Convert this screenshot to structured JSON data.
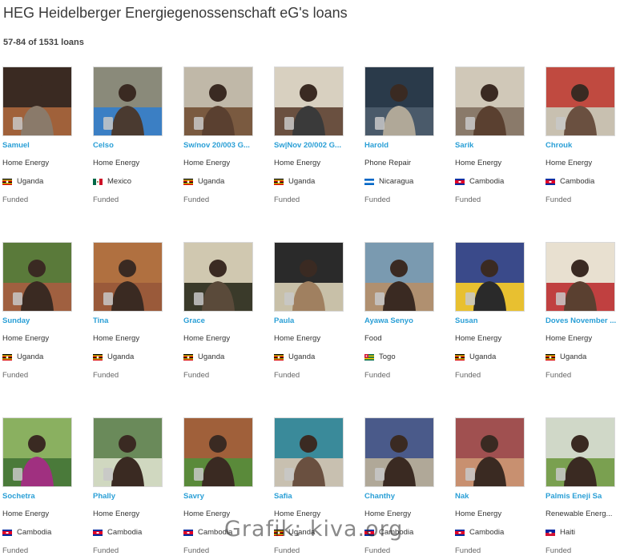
{
  "header": {
    "title": "HEG Heidelberger Energiegenossenschaft eG's loans",
    "count": "57-84 of 1531 loans"
  },
  "colors": {
    "accent_link": "#2a9fd6",
    "text": "#333333",
    "muted": "#666666"
  },
  "loans": [
    {
      "name": "Samuel",
      "sector": "Home Energy",
      "country": "Uganda",
      "flag": "flag-uganda",
      "status": "Funded",
      "photo": "borrower-photo"
    },
    {
      "name": "Celso",
      "sector": "Home Energy",
      "country": "Mexico",
      "flag": "flag-mexico",
      "status": "Funded",
      "photo": "borrower-photo"
    },
    {
      "name": "Sw/nov 20/003 G...",
      "sector": "Home Energy",
      "country": "Uganda",
      "flag": "flag-uganda",
      "status": "Funded",
      "photo": "borrower-photo"
    },
    {
      "name": "Sw|Nov 20/002 G...",
      "sector": "Home Energy",
      "country": "Uganda",
      "flag": "flag-uganda",
      "status": "Funded",
      "photo": "borrower-photo"
    },
    {
      "name": "Harold",
      "sector": "Phone Repair",
      "country": "Nicaragua",
      "flag": "flag-nicaragua",
      "status": "Funded",
      "photo": "borrower-photo"
    },
    {
      "name": "Sarik",
      "sector": "Home Energy",
      "country": "Cambodia",
      "flag": "flag-cambodia",
      "status": "Funded",
      "photo": "borrower-photo"
    },
    {
      "name": "Chrouk",
      "sector": "Home Energy",
      "country": "Cambodia",
      "flag": "flag-cambodia",
      "status": "Funded",
      "photo": "borrower-photo"
    },
    {
      "name": "Sunday",
      "sector": "Home Energy",
      "country": "Uganda",
      "flag": "flag-uganda",
      "status": "Funded",
      "photo": "borrower-photo"
    },
    {
      "name": "Tina",
      "sector": "Home Energy",
      "country": "Uganda",
      "flag": "flag-uganda",
      "status": "Funded",
      "photo": "borrower-photo"
    },
    {
      "name": "Grace",
      "sector": "Home Energy",
      "country": "Uganda",
      "flag": "flag-uganda",
      "status": "Funded",
      "photo": "borrower-photo"
    },
    {
      "name": "Paula",
      "sector": "Home Energy",
      "country": "Uganda",
      "flag": "flag-uganda",
      "status": "Funded",
      "photo": "borrower-photo"
    },
    {
      "name": "Ayawa Senyo",
      "sector": "Food",
      "country": "Togo",
      "flag": "flag-togo",
      "status": "Funded",
      "photo": "borrower-photo"
    },
    {
      "name": "Susan",
      "sector": "Home Energy",
      "country": "Uganda",
      "flag": "flag-uganda",
      "status": "Funded",
      "photo": "borrower-photo"
    },
    {
      "name": "Doves November ...",
      "sector": "Home Energy",
      "country": "Uganda",
      "flag": "flag-uganda",
      "status": "Funded",
      "photo": "borrower-photo"
    },
    {
      "name": "Sochetra",
      "sector": "Home Energy",
      "country": "Cambodia",
      "flag": "flag-cambodia",
      "status": "Funded",
      "photo": "borrower-photo"
    },
    {
      "name": "Phally",
      "sector": "Home Energy",
      "country": "Cambodia",
      "flag": "flag-cambodia",
      "status": "Funded",
      "photo": "borrower-photo"
    },
    {
      "name": "Savry",
      "sector": "Home Energy",
      "country": "Cambodia",
      "flag": "flag-cambodia",
      "status": "Funded",
      "photo": "borrower-photo"
    },
    {
      "name": "Safia",
      "sector": "Home Energy",
      "country": "Uganda",
      "flag": "flag-uganda",
      "status": "Funded",
      "photo": "borrower-photo"
    },
    {
      "name": "Chanthy",
      "sector": "Home Energy",
      "country": "Cambodia",
      "flag": "flag-cambodia",
      "status": "Funded",
      "photo": "borrower-photo"
    },
    {
      "name": "Nak",
      "sector": "Home Energy",
      "country": "Cambodia",
      "flag": "flag-cambodia",
      "status": "Funded",
      "photo": "borrower-photo"
    },
    {
      "name": "Palmis Eneji Sa",
      "sector": "Renewable Energ...",
      "country": "Haiti",
      "flag": "flag-haiti",
      "status": "Funded",
      "photo": "borrower-photo"
    }
  ],
  "watermark": "Grafik: kiva.org"
}
